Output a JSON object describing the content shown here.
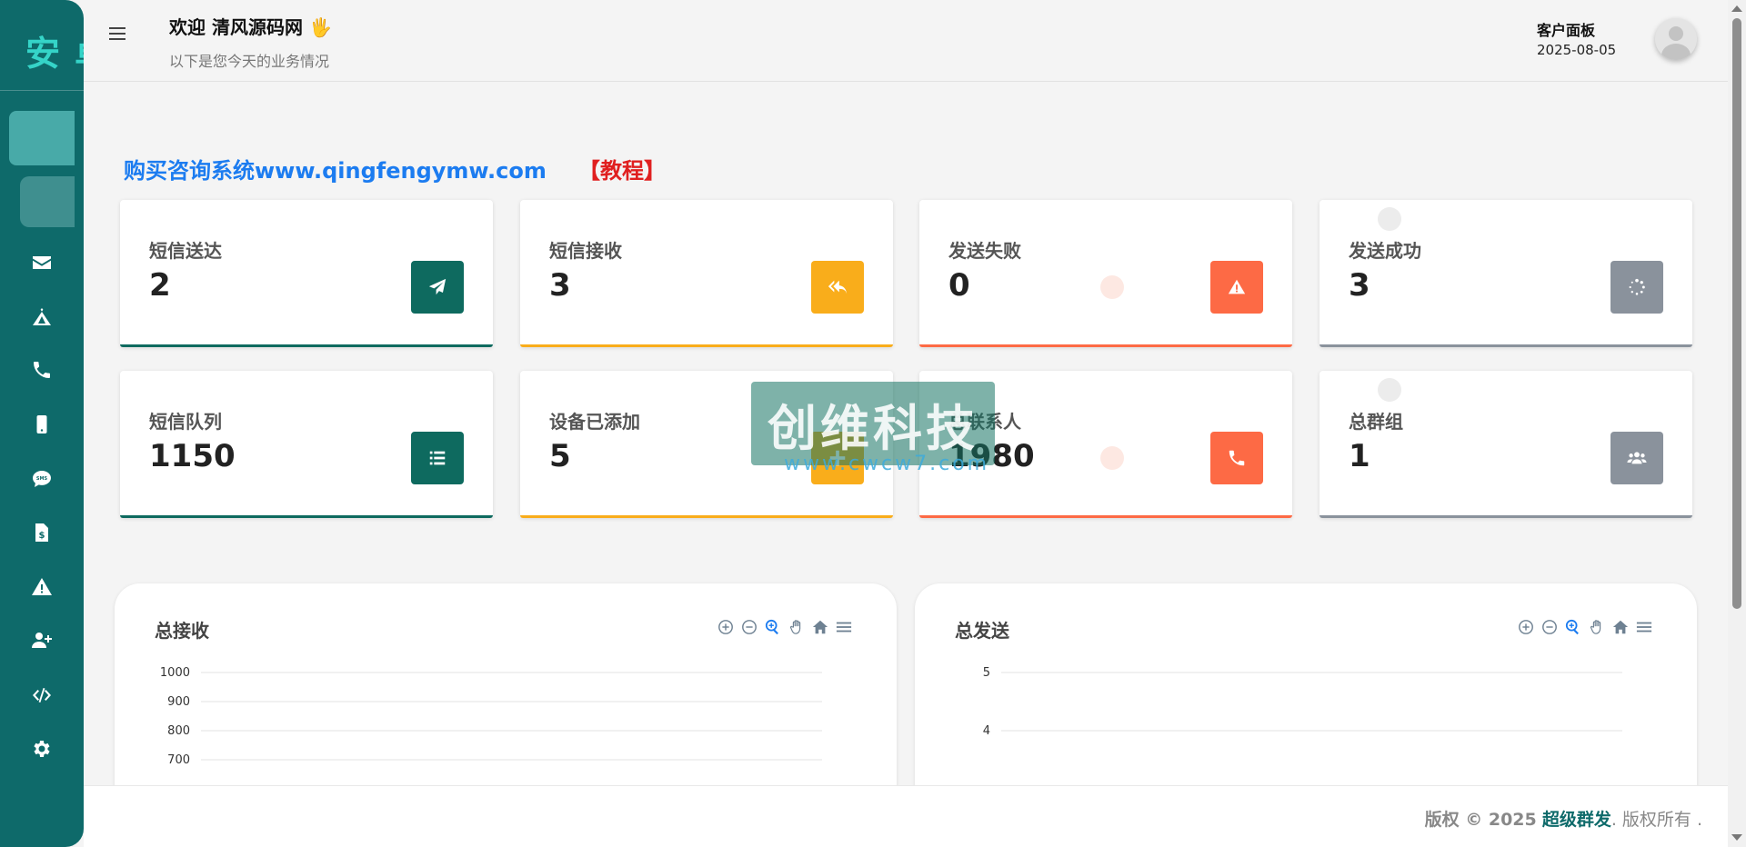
{
  "sidebar": {
    "brand": "安卓",
    "items": [
      {
        "name": "add",
        "icon": "plus-circle-icon"
      },
      {
        "name": "dashboard",
        "icon": "dashboard-icon"
      },
      {
        "name": "messages",
        "icon": "envelope-icon"
      },
      {
        "name": "campaigns",
        "icon": "tent-icon"
      },
      {
        "name": "calls",
        "icon": "phone-icon"
      },
      {
        "name": "devices",
        "icon": "mobile-icon"
      },
      {
        "name": "sms",
        "icon": "sms-bubble-icon"
      },
      {
        "name": "billing",
        "icon": "invoice-dollar-icon"
      },
      {
        "name": "alerts",
        "icon": "warning-icon"
      },
      {
        "name": "add-user",
        "icon": "user-plus-icon"
      },
      {
        "name": "api",
        "icon": "code-icon"
      },
      {
        "name": "settings",
        "icon": "gear-icon"
      }
    ]
  },
  "header": {
    "welcome": "欢迎 清风源码网",
    "hand_icon": "🖐",
    "subtitle": "以下是您今天的业务情况",
    "panel_label": "客户面板",
    "date": "2025-08-05"
  },
  "promo": {
    "text": "购买咨询系统www.qingfengymw.com",
    "tutorial": "【教程】"
  },
  "cards": [
    {
      "label": "短信送达",
      "value": "2",
      "icon": "paper-plane-icon",
      "color": "#0e6a5f"
    },
    {
      "label": "短信接收",
      "value": "3",
      "icon": "reply-all-icon",
      "color": "#f9ad1b"
    },
    {
      "label": "发送失败",
      "value": "0",
      "icon": "warning-icon",
      "color": "#fd6a45"
    },
    {
      "label": "发送成功",
      "value": "3",
      "icon": "spinner-icon",
      "color": "#8a929c"
    },
    {
      "label": "短信队列",
      "value": "1150",
      "icon": "list-icon",
      "color": "#0e6a5f"
    },
    {
      "label": "设备已添加",
      "value": "5",
      "icon": "plus-icon",
      "color": "#f9ad1b"
    },
    {
      "label": "总联系人",
      "value": "1980",
      "icon": "phone-icon",
      "color": "#fd6a45"
    },
    {
      "label": "总群组",
      "value": "1",
      "icon": "users-icon",
      "color": "#8a929c"
    }
  ],
  "charts_meta": {
    "received": {
      "title": "总接收"
    },
    "sent": {
      "title": "总发送"
    }
  },
  "chart_data": [
    {
      "type": "line",
      "title": "总接收",
      "y_ticks_visible": [
        1000,
        900,
        800,
        700
      ],
      "series": [],
      "grid": true
    },
    {
      "type": "line",
      "title": "总发送",
      "y_ticks_visible": [
        5,
        4
      ],
      "series": [],
      "grid": true
    }
  ],
  "footer": {
    "prefix": "版权 © 2025",
    "brand": "超级群发",
    "suffix": ". 版权所有 ."
  },
  "watermark": {
    "text": "创维科技",
    "url": "www.cwcw7.com"
  },
  "colors": {
    "sidebar": "#0e6a6a",
    "promo": "#1c7cf0",
    "tutorial": "#e02020"
  }
}
